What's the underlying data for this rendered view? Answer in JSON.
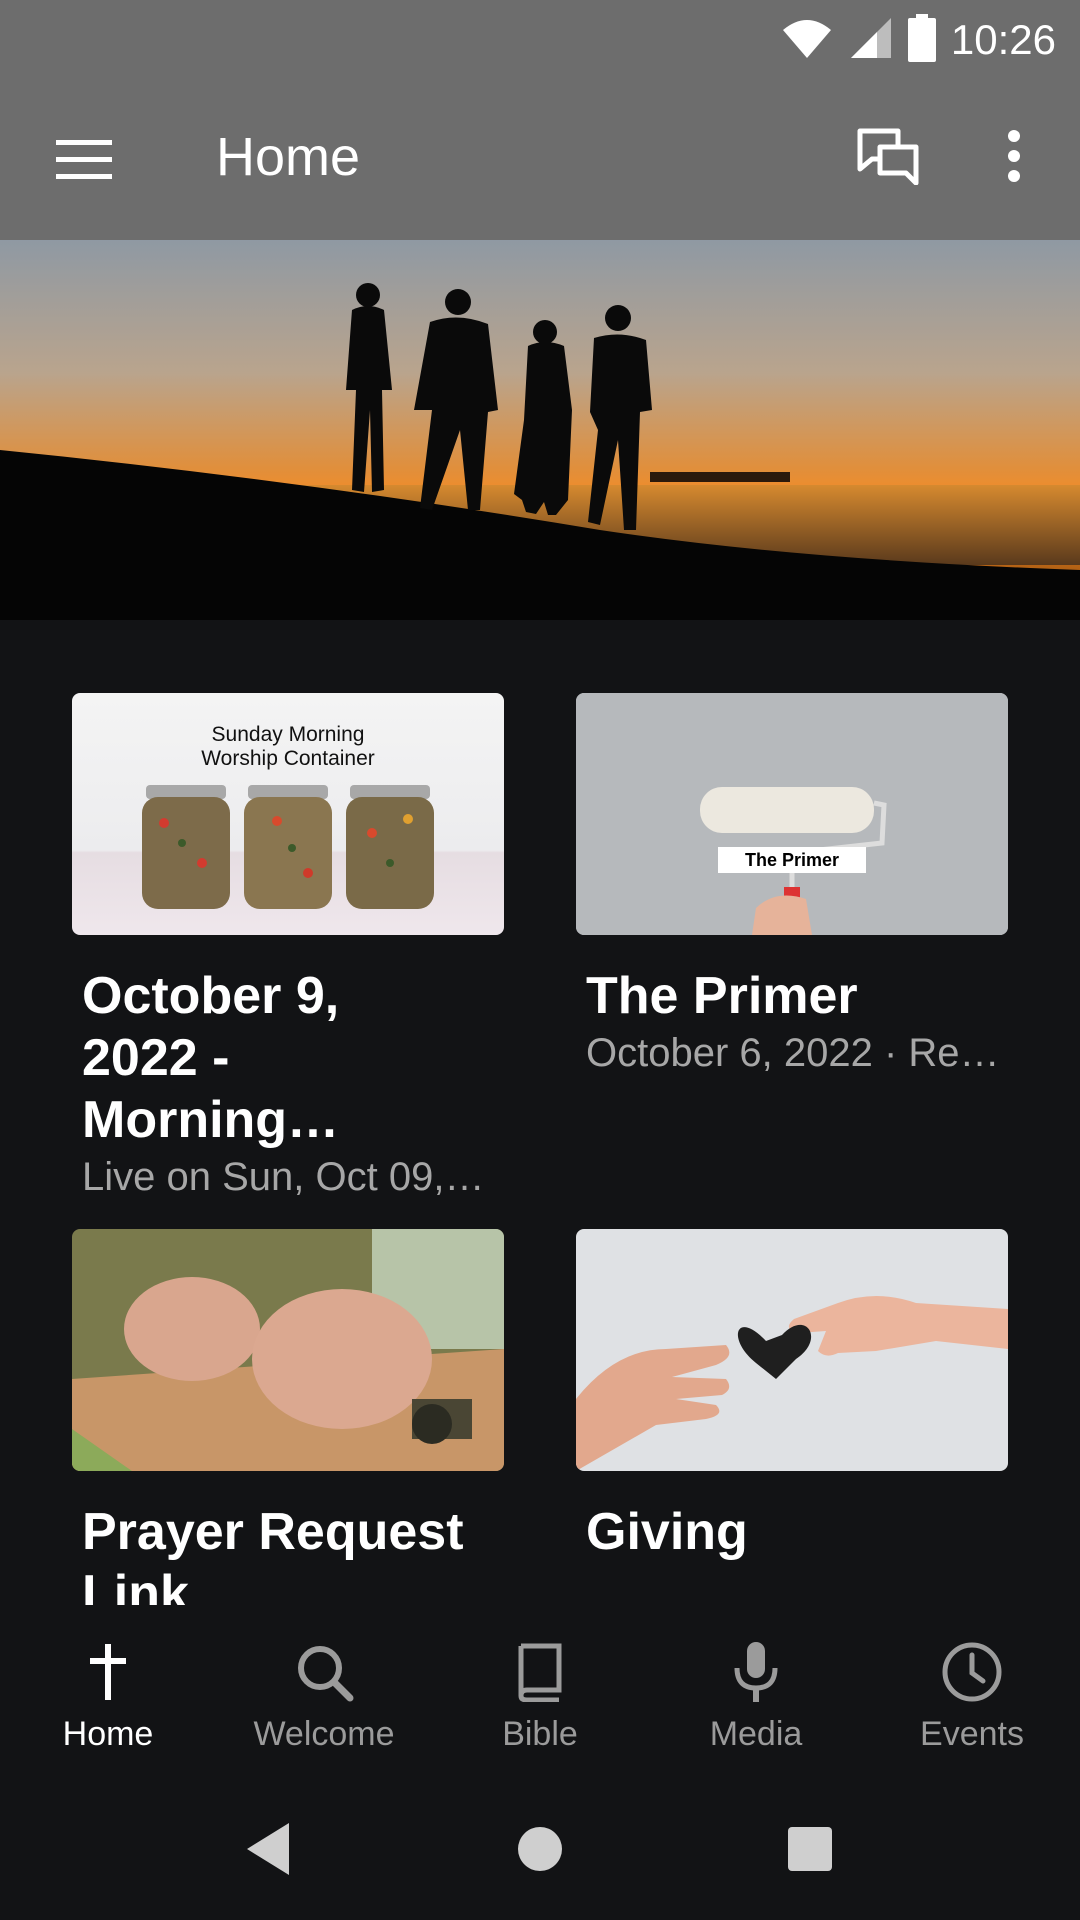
{
  "status_bar": {
    "time": "10:26",
    "icons": [
      "wifi-icon",
      "signal-icon",
      "battery-icon"
    ]
  },
  "app_bar": {
    "title": "Home",
    "icons": [
      "menu-icon",
      "chat-icon",
      "more-vert-icon"
    ]
  },
  "hero": {
    "description_icon": "hero-image"
  },
  "cards": [
    {
      "title": "October 9,\n2022 - Morning…",
      "subtitle": "Live on Sun, Oct 09,…",
      "thumb_text": "Sunday Morning\nWorship Container"
    },
    {
      "title": "The Primer",
      "subtitle": "October 6, 2022 · Re…",
      "thumb_text": "The Primer"
    },
    {
      "title": "Prayer Request\nLink",
      "subtitle": ""
    },
    {
      "title": "Giving",
      "subtitle": ""
    }
  ],
  "bottom_nav": [
    {
      "label": "Home",
      "icon": "cross-icon",
      "active": true
    },
    {
      "label": "Welcome",
      "icon": "search-icon",
      "active": false
    },
    {
      "label": "Bible",
      "icon": "book-icon",
      "active": false
    },
    {
      "label": "Media",
      "icon": "microphone-icon",
      "active": false
    },
    {
      "label": "Events",
      "icon": "clock-icon",
      "active": false
    }
  ],
  "colors": {
    "app_bar": "#6d6d6d",
    "background": "#121315",
    "nav_active": "#ffffff",
    "nav_inactive": "#9b9b9b",
    "subtitle": "#a7a7a7"
  }
}
